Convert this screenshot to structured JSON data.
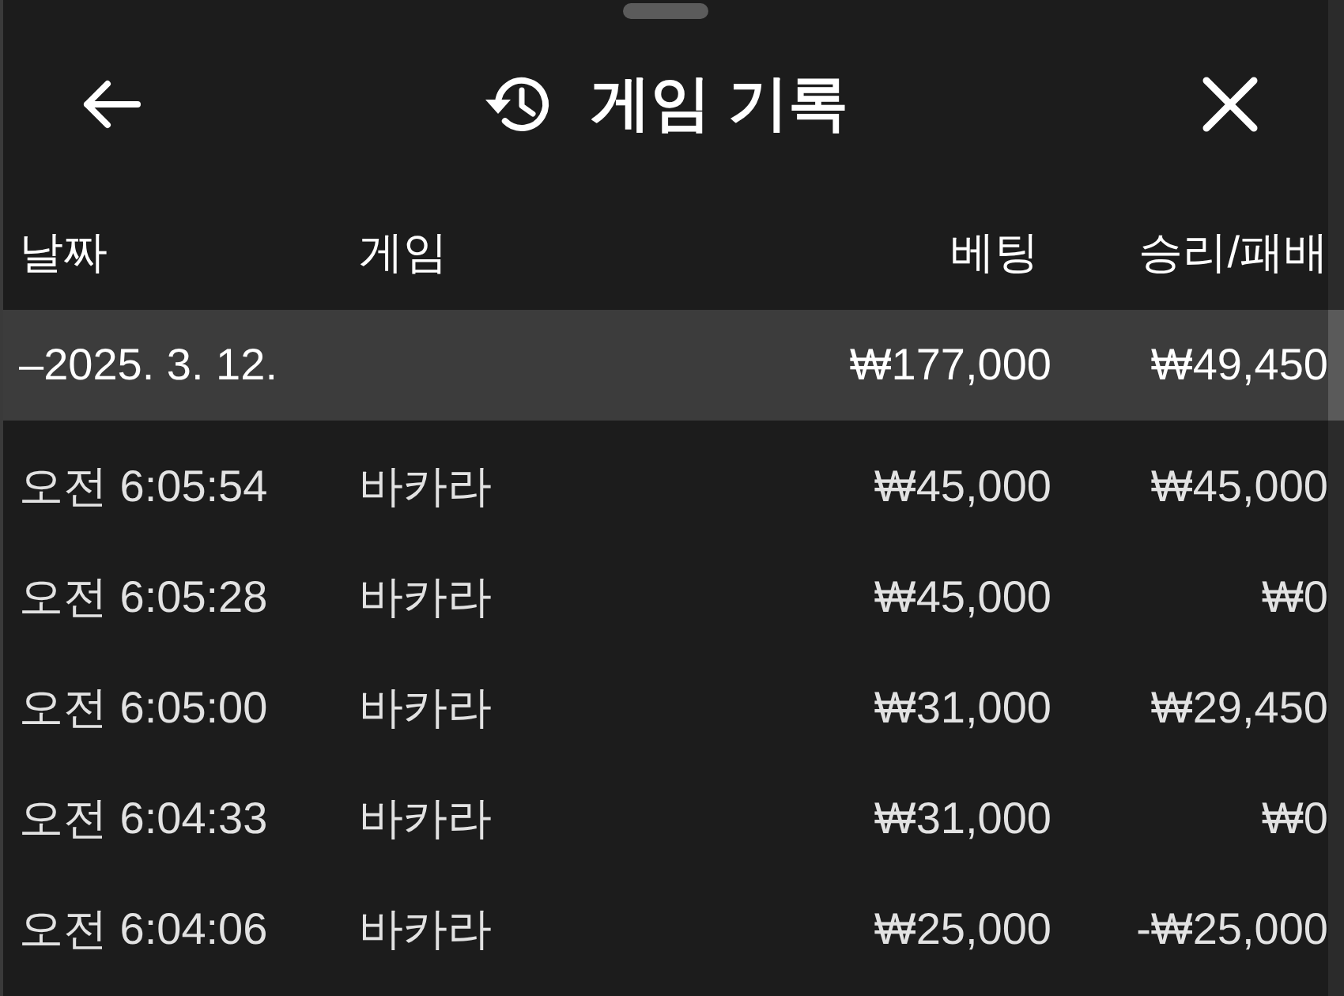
{
  "window": {
    "title": "게임 기록"
  },
  "table": {
    "columns": [
      "날짜",
      "게임",
      "베팅",
      "승리/패배"
    ],
    "rows": [
      {
        "kind": "group",
        "date": "–2025. 3. 12.",
        "bet": "₩177,000",
        "result": "₩49,450"
      },
      {
        "kind": "entry",
        "time": "오전 6:05:54",
        "game": "바카라",
        "bet": "₩45,000",
        "result": "₩45,000"
      },
      {
        "kind": "entry",
        "time": "오전 6:05:28",
        "game": "바카라",
        "bet": "₩45,000",
        "result": "₩0"
      },
      {
        "kind": "entry",
        "time": "오전 6:05:00",
        "game": "바카라",
        "bet": "₩31,000",
        "result": "₩29,450"
      },
      {
        "kind": "entry",
        "time": "오전 6:04:33",
        "game": "바카라",
        "bet": "₩31,000",
        "result": "₩0"
      },
      {
        "kind": "entry",
        "time": "오전 6:04:06",
        "game": "바카라",
        "bet": "₩25,000",
        "result": "-₩25,000"
      }
    ]
  }
}
